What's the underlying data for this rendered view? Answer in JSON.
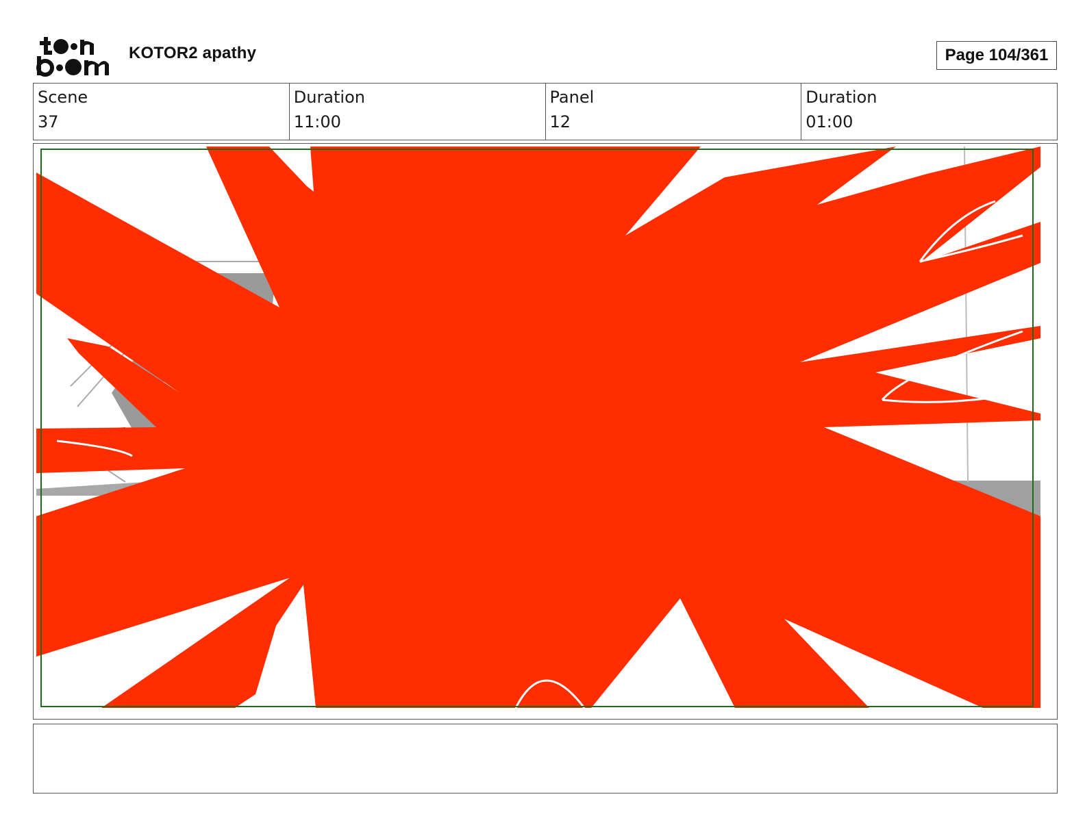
{
  "header": {
    "logo_alt": "toon boom",
    "project_title": "KOTOR2 apathy",
    "page_label": "Page 104/361"
  },
  "info": [
    {
      "label": "Scene",
      "value": "37"
    },
    {
      "label": "Duration",
      "value": "11:00"
    },
    {
      "label": "Panel",
      "value": "12"
    },
    {
      "label": "Duration",
      "value": "01:00"
    }
  ],
  "panel": {
    "image_icon": "storyboard-panel-drawing",
    "colors": {
      "splash": "#ff2d00",
      "safe_frame": "#1e6b1e",
      "shadow": "#9a9a9a"
    }
  },
  "notes": {
    "text": ""
  }
}
